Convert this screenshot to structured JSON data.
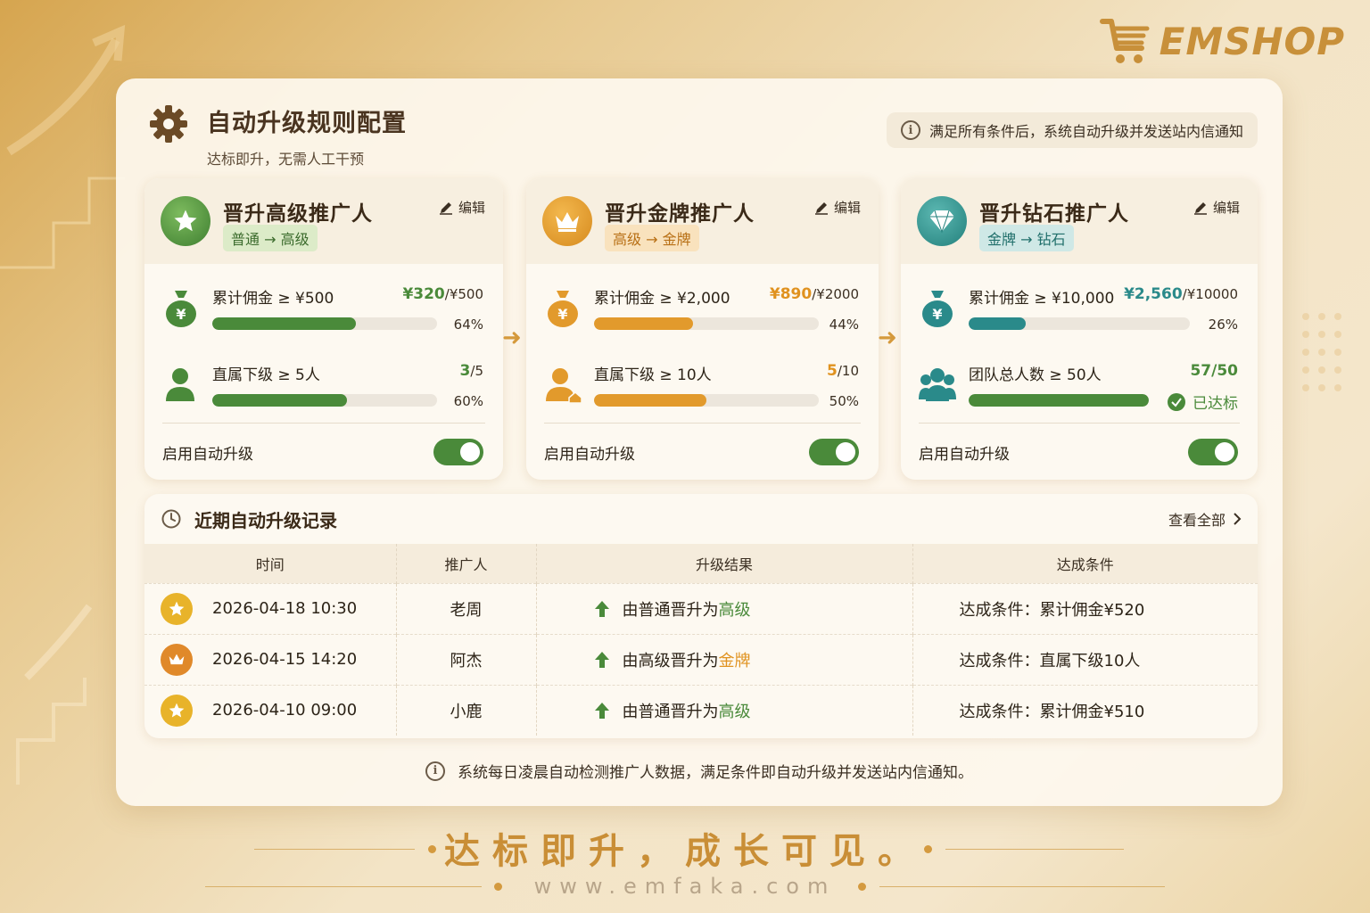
{
  "brand": {
    "name": "EMSHOP"
  },
  "header": {
    "title": "自动升级规则配置",
    "subtitle": "达标即升，无需人工干预",
    "notice": "满足所有条件后，系统自动升级并发送站内信通知"
  },
  "cards": [
    {
      "title": "晋升高级推广人",
      "tier": "普通 → 高级",
      "edit": "编辑",
      "accent": "#4a8a3a",
      "conditions": [
        {
          "label": "累计佣金 ≥ ¥500",
          "current": "¥320",
          "total": "/¥500",
          "percent": "64%",
          "fill": 0.64
        },
        {
          "label": "直属下级 ≥ 5人",
          "current": "3",
          "total": "/5",
          "percent": "60%",
          "fill": 0.6
        }
      ],
      "toggle_label": "启用自动升级"
    },
    {
      "title": "晋升金牌推广人",
      "tier": "高级 → 金牌",
      "edit": "编辑",
      "accent": "#e29a2c",
      "conditions": [
        {
          "label": "累计佣金 ≥ ¥2,000",
          "current": "¥890",
          "total": "/¥2000",
          "percent": "44%",
          "fill": 0.44
        },
        {
          "label": "直属下级 ≥ 10人",
          "current": "5",
          "total": "/10",
          "percent": "50%",
          "fill": 0.5
        }
      ],
      "toggle_label": "启用自动升级"
    },
    {
      "title": "晋升钻石推广人",
      "tier": "金牌 → 钻石",
      "edit": "编辑",
      "accent": "#2a8a8a",
      "conditions": [
        {
          "label": "累计佣金 ≥ ¥10,000",
          "current": "¥2,560",
          "total": "/¥10000",
          "percent": "26%",
          "fill": 0.26
        },
        {
          "label": "团队总人数 ≥ 50人",
          "current": "57/50",
          "total": "",
          "percent": "已达标",
          "fill": 1.0
        }
      ],
      "toggle_label": "启用自动升级"
    }
  ],
  "records": {
    "title": "近期自动升级记录",
    "view_all": "查看全部",
    "columns": [
      "时间",
      "推广人",
      "升级结果",
      "达成条件"
    ],
    "rows": [
      {
        "time": "2026-04-18 10:30",
        "name": "老周",
        "result_prefix": "由普通晋升为",
        "result_level": "高级",
        "condition": "达成条件：累计佣金¥520"
      },
      {
        "time": "2026-04-15 14:20",
        "name": "阿杰",
        "result_prefix": "由高级晋升为",
        "result_level": "金牌",
        "condition": "达成条件：直属下级10人"
      },
      {
        "time": "2026-04-10 09:00",
        "name": "小鹿",
        "result_prefix": "由普通晋升为",
        "result_level": "高级",
        "condition": "达成条件：累计佣金¥510"
      }
    ]
  },
  "footer_note": "系统每日凌晨自动检测推广人数据，满足条件即自动升级并发送站内信通知。",
  "slogan": "达标即升，成长可见。",
  "site": "www.emfaka.com"
}
